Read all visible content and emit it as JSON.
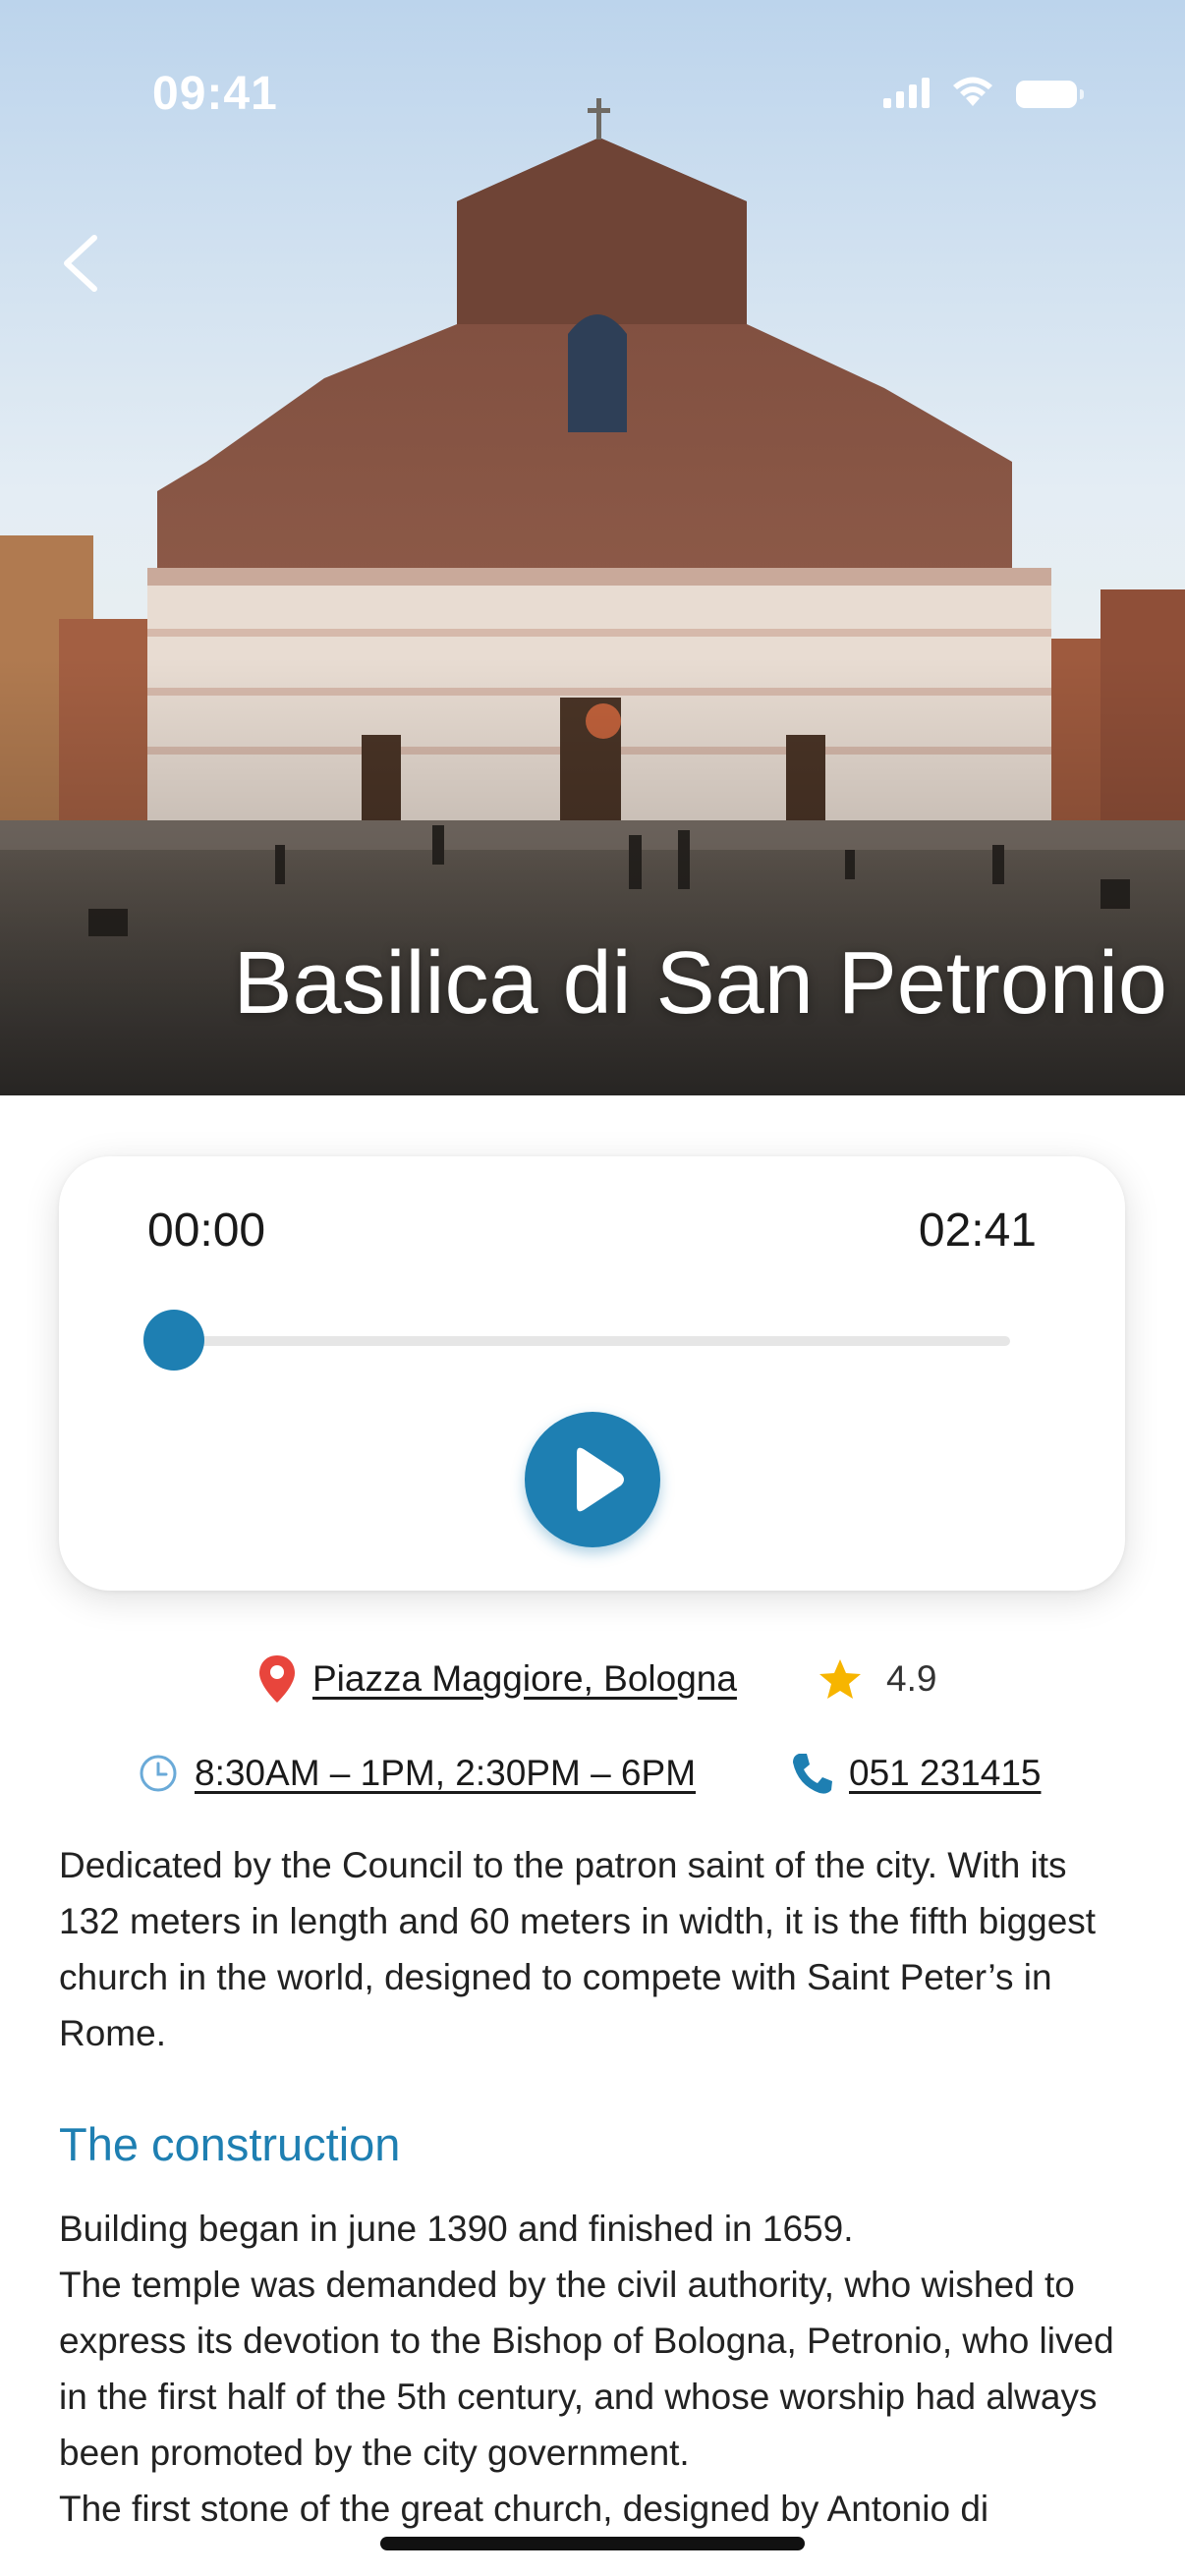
{
  "status_bar": {
    "time": "09:41"
  },
  "hero": {
    "title": "Basilica di San Petronio",
    "back_icon": "chevron-left-icon"
  },
  "player": {
    "current_time": "00:00",
    "total_time": "02:41",
    "progress_fraction": 0,
    "play_icon": "play-icon"
  },
  "info": {
    "address": "Piazza Maggiore, Bologna",
    "address_icon": "location-pin-icon",
    "rating": "4.9",
    "rating_icon": "star-icon",
    "hours": "8:30AM – 1PM, 2:30PM – 6PM",
    "hours_icon": "clock-icon",
    "phone": "051 231415",
    "phone_icon": "phone-icon"
  },
  "content": {
    "description": "Dedicated by the Council to the patron saint of the city. With its 132 meters in length and 60 meters in width, it is the fifth biggest church in the world, designed to compete with Saint Peter’s in Rome.",
    "section_title": "The construction",
    "section_lines": [
      "Building began in june 1390 and finished in 1659.",
      "The temple was demanded by the civil authority, who wished to express its devotion to the Bishop of Bologna, Petronio, who lived in the first half of the 5th century, and whose worship had always been promoted by the city government.",
      "The first stone of the great church, designed by Antonio di"
    ]
  },
  "colors": {
    "accent": "#1e7fb2",
    "pin": "#e8453c",
    "star": "#f7b500",
    "clock": "#6aaad8"
  }
}
